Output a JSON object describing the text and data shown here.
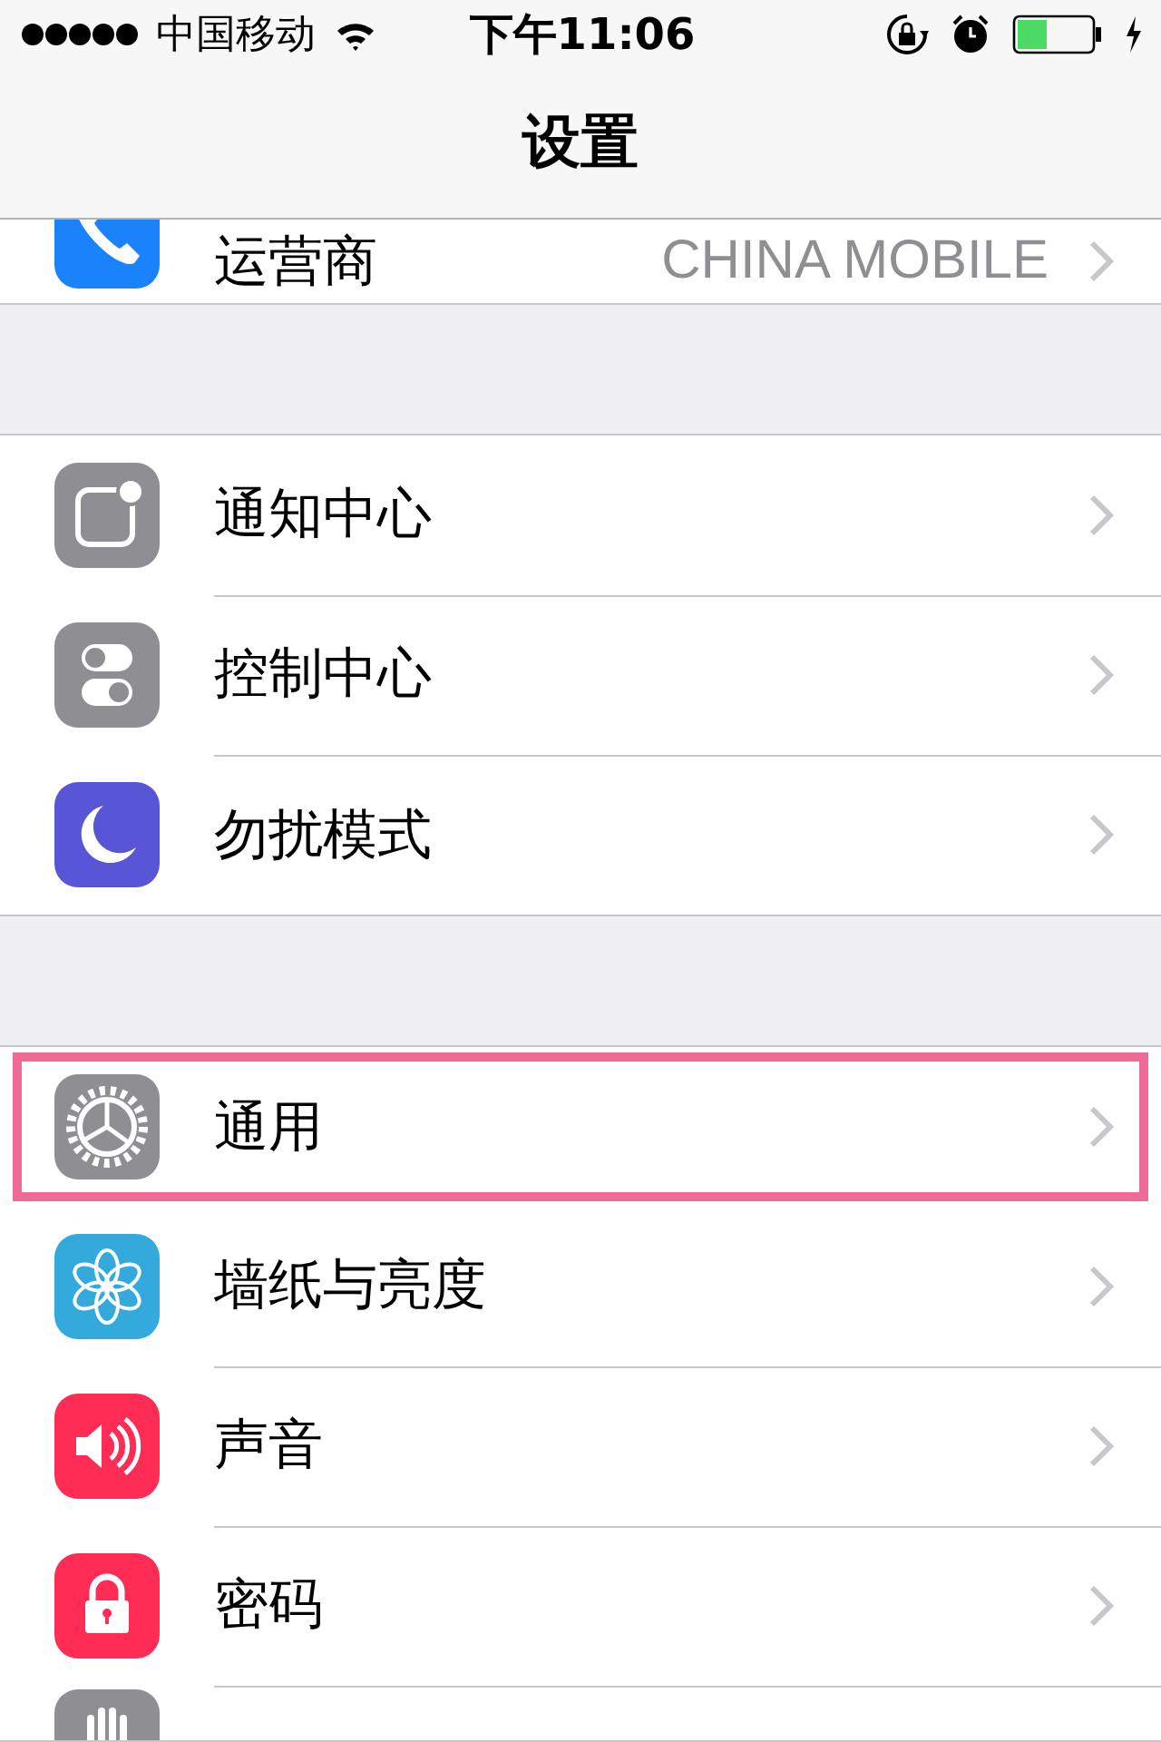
{
  "status_bar": {
    "carrier": "中国移动",
    "time": "下午11:06"
  },
  "nav": {
    "title": "设置"
  },
  "groups": [
    {
      "items": [
        {
          "label": "运营商",
          "value": "CHINA MOBILE",
          "color": "#1a82fb",
          "highlighted": false
        }
      ]
    },
    {
      "items": [
        {
          "label": "通知中心",
          "color": "#8e8e93",
          "highlighted": false
        },
        {
          "label": "控制中心",
          "color": "#8e8e93",
          "highlighted": false
        },
        {
          "label": "勿扰模式",
          "color": "#5856d6",
          "highlighted": false
        }
      ]
    },
    {
      "items": [
        {
          "label": "通用",
          "color": "#8e8e93",
          "highlighted": true
        },
        {
          "label": "墙纸与亮度",
          "color": "#34aadc",
          "highlighted": false
        },
        {
          "label": "声音",
          "color": "#ff2d55",
          "highlighted": false
        },
        {
          "label": "密码",
          "color": "#ff2d55",
          "highlighted": false
        },
        {
          "color": "#8e8e93",
          "highlighted": false
        }
      ]
    }
  ]
}
